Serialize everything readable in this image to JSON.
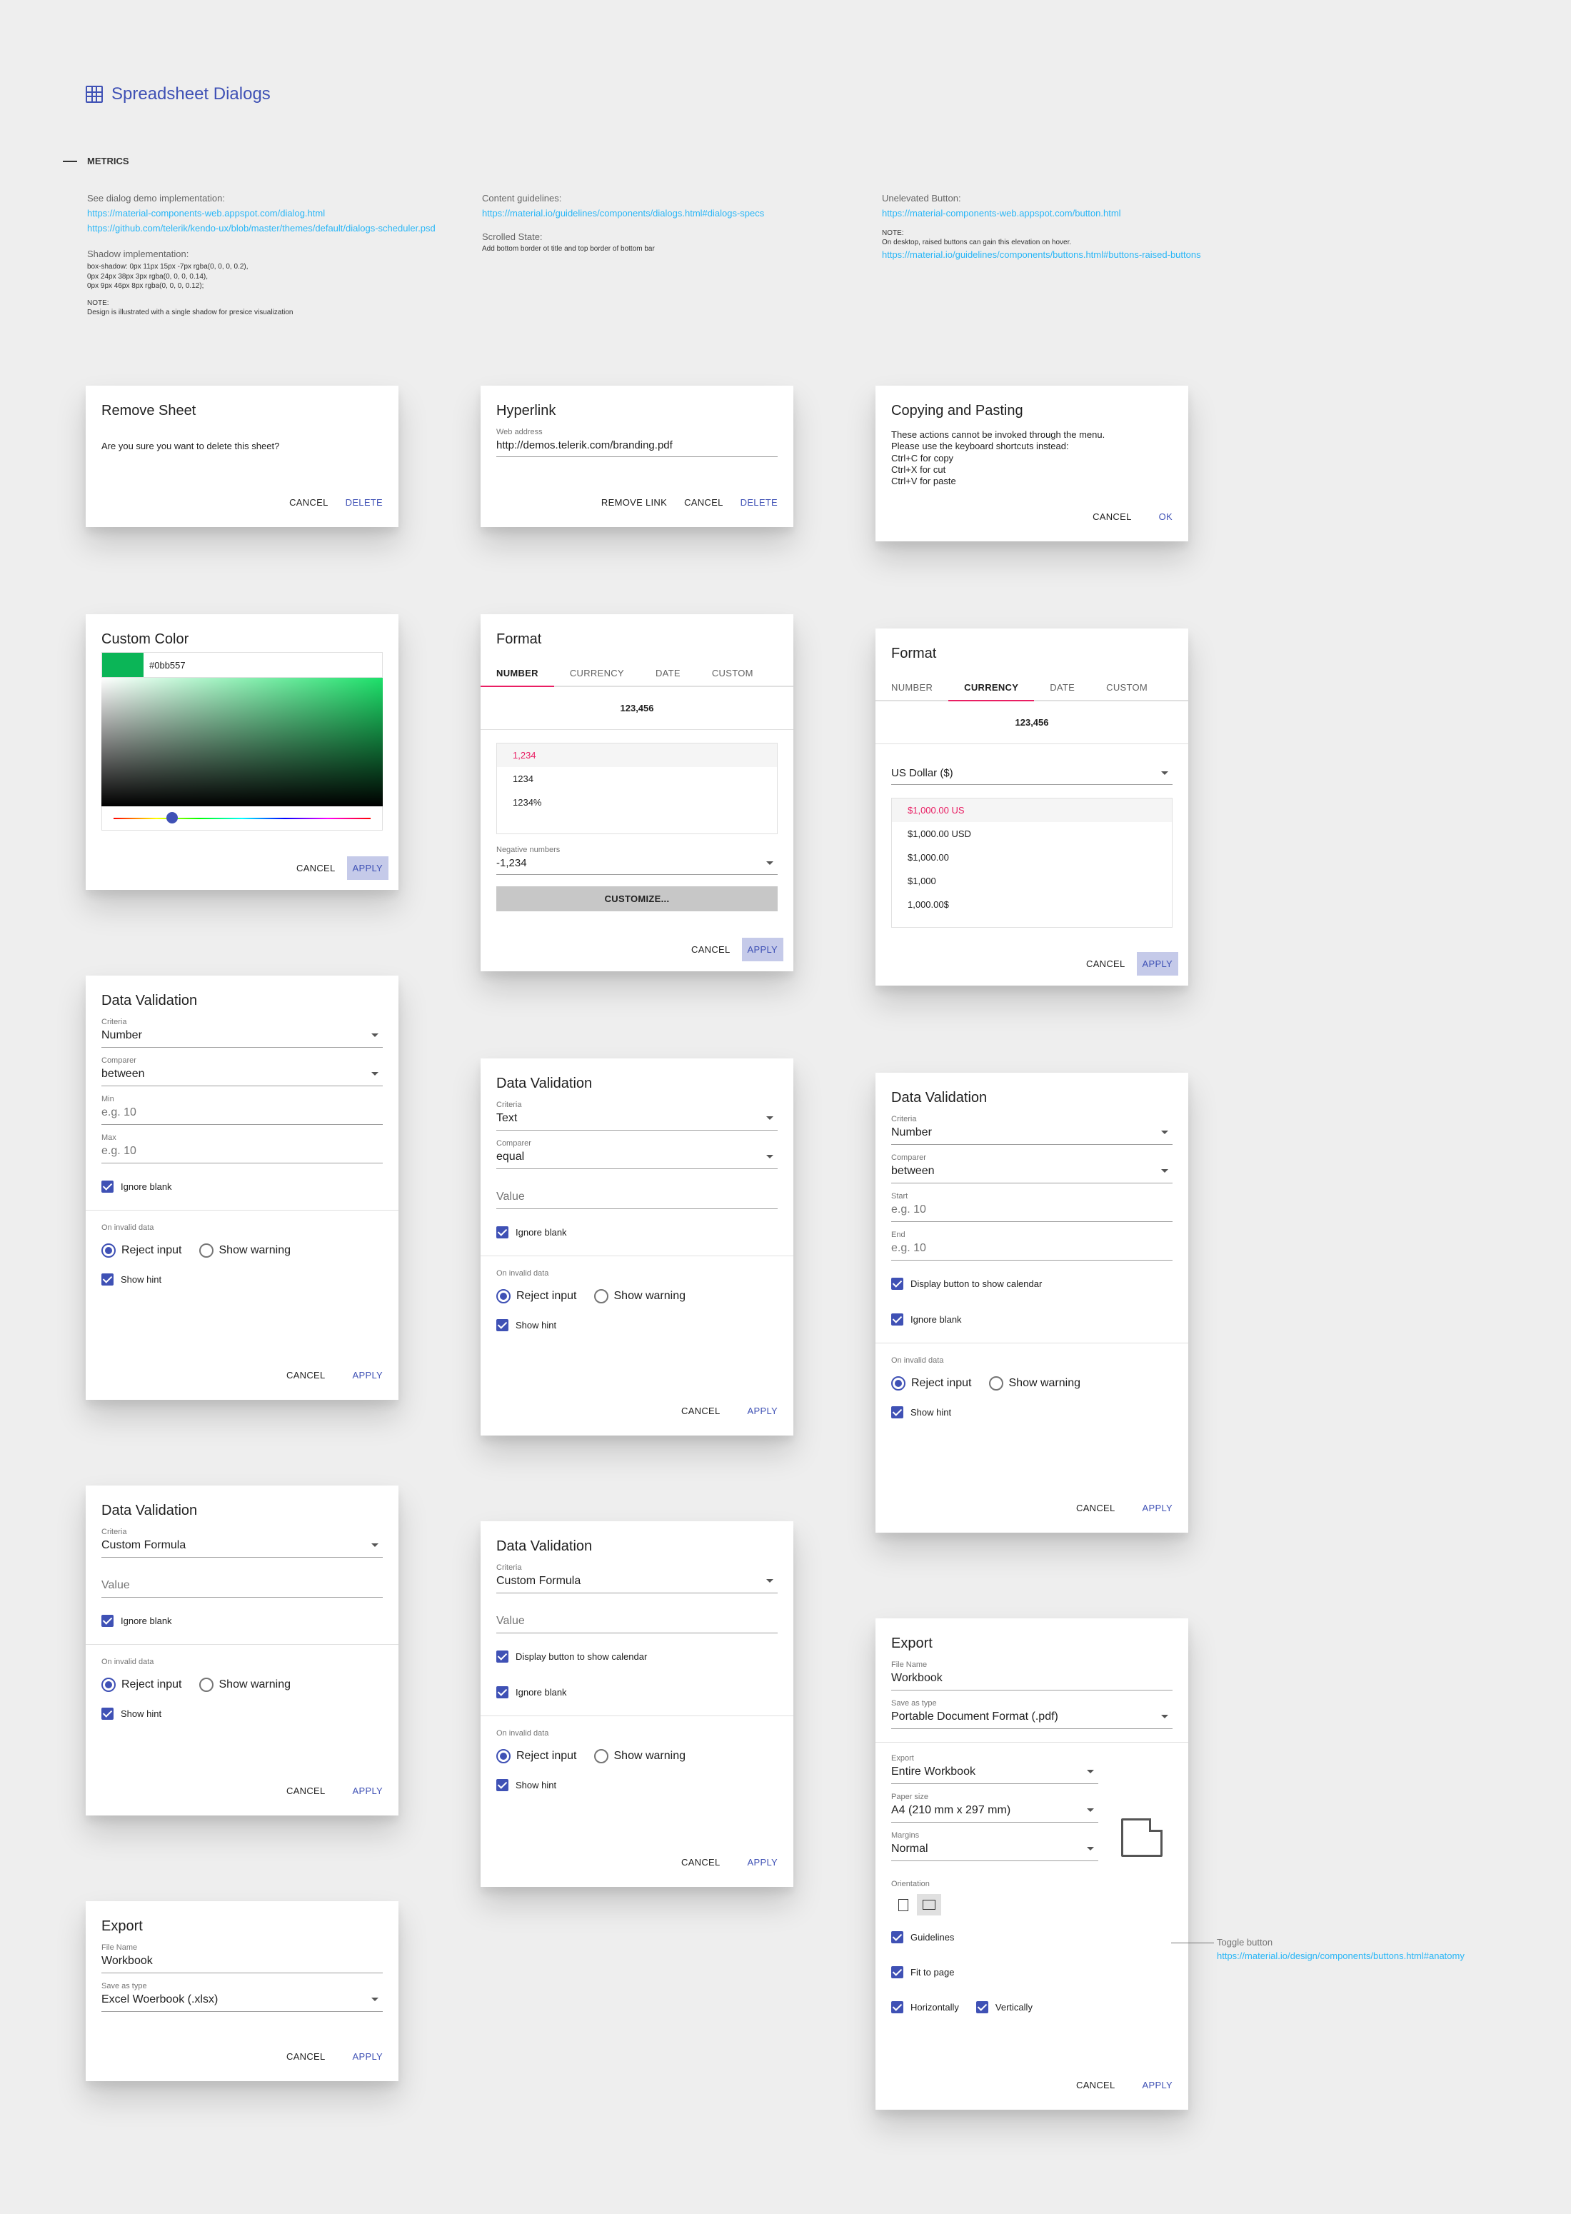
{
  "page": {
    "title": "Spreadsheet Dialogs",
    "section": "METRICS"
  },
  "metrics": {
    "col1": {
      "label1": "See dialog demo implementation:",
      "link1": "https://material-components-web.appspot.com/dialog.html",
      "link2": "https://github.com/telerik/kendo-ux/blob/master/themes/default/dialogs-scheduler.psd",
      "label2": "Shadow implementation:",
      "shadow1": "box-shadow: 0px 11px 15px -7px rgba(0, 0, 0, 0.2),",
      "shadow2": "0px 24px 38px 3px rgba(0, 0, 0, 0.14),",
      "shadow3": "0px 9px 46px 8px rgba(0, 0, 0, 0.12);",
      "note_label": "NOTE:",
      "note": "Design is illustrated with a single shadow for presice visualization"
    },
    "col2": {
      "label1": "Content guidelines:",
      "link1": "https://material.io/guidelines/components/dialogs.html#dialogs-specs",
      "label2": "Scrolled State:",
      "text2": "Add bottom border ot title and top border of bottom bar"
    },
    "col3": {
      "label1": "Unelevated Button:",
      "link1": "https://material-components-web.appspot.com/button.html",
      "note_label": "NOTE:",
      "note": "On desktop, raised buttons can gain this elevation on hover.",
      "link2": "https://material.io/guidelines/components/buttons.html#buttons-raised-buttons"
    }
  },
  "common": {
    "cancel": "CANCEL",
    "apply": "APPLY",
    "delete": "DELETE",
    "ok": "OK",
    "remove_link": "REMOVE LINK"
  },
  "remove_sheet": {
    "title": "Remove Sheet",
    "text": "Are you sure you want to delete this sheet?"
  },
  "hyperlink": {
    "title": "Hyperlink",
    "label": "Web address",
    "value": "http://demos.telerik.com/branding.pdf"
  },
  "copy_paste": {
    "title": "Copying and Pasting",
    "lines": [
      "These actions cannot be invoked through the menu.",
      "Please use the keyboard shortcuts instead:",
      "Ctrl+C for copy",
      "Ctrl+X for cut",
      "Ctrl+V for paste"
    ]
  },
  "custom_color": {
    "title": "Custom Color",
    "hex": "#0bb557",
    "color": "#0bb557"
  },
  "format_number": {
    "title": "Format",
    "tabs": [
      "NUMBER",
      "CURRENCY",
      "DATE",
      "CUSTOM"
    ],
    "preview": "123,456",
    "items": [
      "1,234",
      "1234",
      "1234%"
    ],
    "neg_label": "Negative numbers",
    "neg_value": "-1,234",
    "customize": "CUSTOMIZE..."
  },
  "format_currency": {
    "title": "Format",
    "tabs": [
      "NUMBER",
      "CURRENCY",
      "DATE",
      "CUSTOM"
    ],
    "preview": "123,456",
    "currency": "US Dollar ($)",
    "items": [
      "$1,000.00 US",
      "$1,000.00 USD",
      "$1,000.00",
      "$1,000",
      "1,000.00$"
    ]
  },
  "dv_number": {
    "title": "Data Validation",
    "criteria_label": "Criteria",
    "criteria": "Number",
    "comparer_label": "Comparer",
    "comparer": "between",
    "min_label": "Min",
    "min_ph": "e.g. 10",
    "max_label": "Max",
    "max_ph": "e.g. 10",
    "ignore": "Ignore blank",
    "invalid_label": "On invalid data",
    "reject": "Reject input",
    "warning": "Show warning",
    "hint": "Show hint"
  },
  "dv_text": {
    "title": "Data Validation",
    "criteria_label": "Criteria",
    "criteria": "Text",
    "comparer_label": "Comparer",
    "comparer": "equal",
    "value_ph": "Value",
    "ignore": "Ignore blank",
    "invalid_label": "On invalid data",
    "reject": "Reject input",
    "warning": "Show warning",
    "hint": "Show hint"
  },
  "dv_date": {
    "title": "Data Validation",
    "criteria_label": "Criteria",
    "criteria": "Number",
    "comparer_label": "Comparer",
    "comparer": "between",
    "start_label": "Start",
    "start_ph": "e.g. 10",
    "end_label": "End",
    "end_ph": "e.g. 10",
    "calendar": "Display button to show calendar",
    "ignore": "Ignore blank",
    "invalid_label": "On invalid data",
    "reject": "Reject input",
    "warning": "Show warning",
    "hint": "Show hint"
  },
  "dv_formula": {
    "title": "Data Validation",
    "criteria_label": "Criteria",
    "criteria": "Custom Formula",
    "value_ph": "Value",
    "ignore": "Ignore blank",
    "invalid_label": "On invalid data",
    "reject": "Reject input",
    "warning": "Show warning",
    "hint": "Show hint"
  },
  "dv_formula2": {
    "title": "Data Validation",
    "criteria_label": "Criteria",
    "criteria": "Custom Formula",
    "value_ph": "Value",
    "calendar": "Display button to show calendar",
    "ignore": "Ignore blank",
    "invalid_label": "On invalid data",
    "reject": "Reject input",
    "warning": "Show warning",
    "hint": "Show hint"
  },
  "export_xlsx": {
    "title": "Export",
    "file_label": "File Name",
    "file": "Workbook",
    "type_label": "Save as type",
    "type": "Excel Woerbook (.xlsx)"
  },
  "export_pdf": {
    "title": "Export",
    "file_label": "File Name",
    "file": "Workbook",
    "type_label": "Save as type",
    "type": "Portable Document Format (.pdf)",
    "export_label": "Export",
    "export": "Entire Workbook",
    "paper_label": "Paper size",
    "paper": "A4 (210 mm x 297 mm)",
    "margins_label": "Margins",
    "margins": "Normal",
    "orient_label": "Orientation",
    "guidelines": "Guidelines",
    "fit": "Fit to page",
    "horizontally": "Horizontally",
    "vertically": "Vertically"
  },
  "annotation": {
    "label": "Toggle button",
    "link": "https://material.io/design/components/buttons.html#anatomy"
  }
}
